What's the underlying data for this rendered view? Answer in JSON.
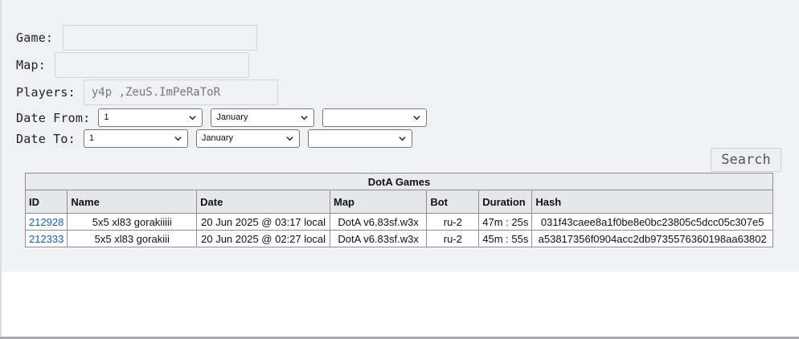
{
  "form": {
    "game_label": "Game:",
    "game_value": "",
    "map_label": "Map:",
    "map_value": "",
    "players_label": "Players:",
    "players_value": "y4p ,ZeuS.ImPeRaToR",
    "date_from_label": "Date From:",
    "date_from_day": "1",
    "date_from_month": "January",
    "date_from_year": "",
    "date_to_label": "Date To:",
    "date_to_day": "1",
    "date_to_month": "January",
    "date_to_year": "",
    "search_label": "Search"
  },
  "table": {
    "caption": "DotA Games",
    "columns": [
      "ID",
      "Name",
      "Date",
      "Map",
      "Bot",
      "Duration",
      "Hash"
    ],
    "rows": [
      {
        "id": "212928",
        "name": "5x5 xl83 gorakiiiii",
        "date": "20 Jun 2025 @ 03:17 local",
        "map": "DotA v6.83sf.w3x",
        "bot": "ru-2",
        "duration": "47m : 25s",
        "hash": "031f43caee8a1f0be8e0bc23805c5dcc05c307e5"
      },
      {
        "id": "212333",
        "name": "5x5 xl83 gorakiii",
        "date": "20 Jun 2025 @ 02:27 local",
        "map": "DotA v6.83sf.w3x",
        "bot": "ru-2",
        "duration": "45m : 55s",
        "hash": "a53817356f0904acc2db9735576360198aa63802"
      }
    ]
  },
  "icons": {
    "select_arrow": "chevron-down-icon"
  },
  "colors": {
    "panel_bg": "#f0f1f5",
    "link": "#1a5fb0"
  }
}
